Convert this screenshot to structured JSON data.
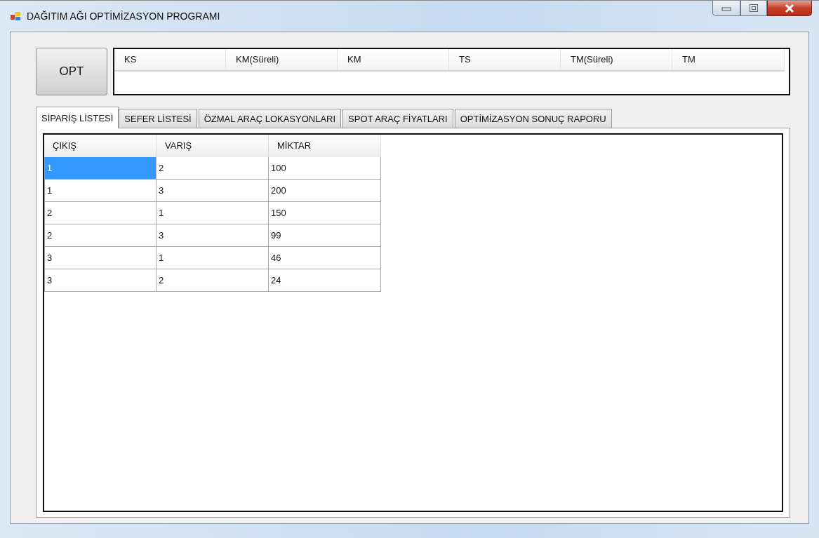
{
  "window": {
    "title": "DAĞITIM AĞI OPTİMİZASYON PROGRAMI"
  },
  "opt_button": {
    "label": "OPT"
  },
  "results": {
    "columns": [
      "KS",
      "KM(Süreli)",
      "KM",
      "TS",
      "TM(Süreli)",
      "TM"
    ]
  },
  "tabs": [
    {
      "label": "SİPARİŞ LİSTESİ",
      "selected": true
    },
    {
      "label": "SEFER LİSTESİ",
      "selected": false
    },
    {
      "label": "ÖZMAL ARAÇ LOKASYONLARI",
      "selected": false
    },
    {
      "label": "SPOT ARAÇ FİYATLARI",
      "selected": false
    },
    {
      "label": "OPTİMİZASYON SONUÇ RAPORU",
      "selected": false
    }
  ],
  "table": {
    "columns": [
      "ÇIKIŞ",
      "VARIŞ",
      "MİKTAR"
    ],
    "rows": [
      [
        {
          "text": "1",
          "selected": true
        },
        {
          "text": "2",
          "selected": false
        },
        {
          "text": "100",
          "selected": false
        }
      ],
      [
        {
          "text": "1",
          "selected": false
        },
        {
          "text": "3",
          "selected": false
        },
        {
          "text": "200",
          "selected": false
        }
      ],
      [
        {
          "text": "2",
          "selected": false
        },
        {
          "text": "1",
          "selected": false
        },
        {
          "text": "150",
          "selected": false
        }
      ],
      [
        {
          "text": "2",
          "selected": false
        },
        {
          "text": "3",
          "selected": false
        },
        {
          "text": "99",
          "selected": false
        }
      ],
      [
        {
          "text": "3",
          "selected": false
        },
        {
          "text": "1",
          "selected": false
        },
        {
          "text": "46",
          "selected": false
        }
      ],
      [
        {
          "text": "3",
          "selected": false
        },
        {
          "text": "2",
          "selected": false
        },
        {
          "text": "24",
          "selected": false
        }
      ]
    ]
  }
}
